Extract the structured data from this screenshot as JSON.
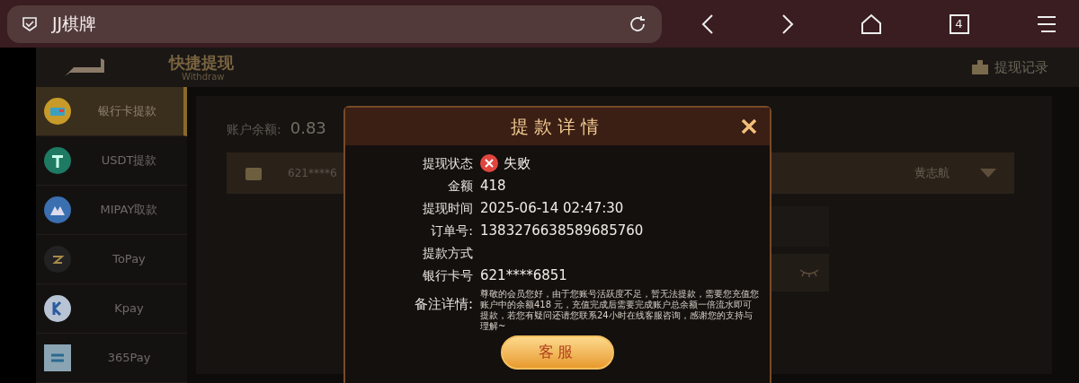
{
  "browser": {
    "page_title": "JJ棋牌",
    "tab_count": "4"
  },
  "header": {
    "title": "快捷提现",
    "subtitle": "Withdraw",
    "history_link": "提现记录"
  },
  "sidebar": {
    "items": [
      {
        "label": "银行卡提款",
        "kind": "bank",
        "selected": true
      },
      {
        "label": "USDT提款",
        "kind": "usdt",
        "selected": false
      },
      {
        "label": "MIPAY取款",
        "kind": "mipay",
        "selected": false
      },
      {
        "label": "ToPay",
        "kind": "topay",
        "selected": false
      },
      {
        "label": "Kpay",
        "kind": "kpay",
        "selected": false
      },
      {
        "label": "365Pay",
        "kind": "pay365",
        "selected": false
      }
    ]
  },
  "account": {
    "balance_label": "账户余额:",
    "balance": "0.83",
    "card_number": "621****6",
    "holder_name": "黄志航"
  },
  "dialog": {
    "title": "提款详情",
    "rows": [
      {
        "label": "提现状态",
        "value": "失败",
        "kind": "status"
      },
      {
        "label": "金额",
        "value": "418",
        "kind": "text"
      },
      {
        "label": "提现时间",
        "value": "2025-06-14 02:47:30",
        "kind": "text"
      },
      {
        "label": "订单号:",
        "value": "1383276638589685760",
        "kind": "text"
      },
      {
        "label": "提款方式",
        "kind": "text"
      },
      {
        "label": "银行卡号",
        "value": "621****6851",
        "kind": "text"
      }
    ],
    "remark_label": "备注详情:",
    "remark": "尊敬的会员您好，由于您账号活跃度不足，暂无法提款，需要您充值您账户中的余额418 元，充值完成后需要完成账户总余额一倍流水即可提款，若您有疑问还请您联系24小时在线客服咨询，感谢您的支持与理解~",
    "button": "客服"
  }
}
